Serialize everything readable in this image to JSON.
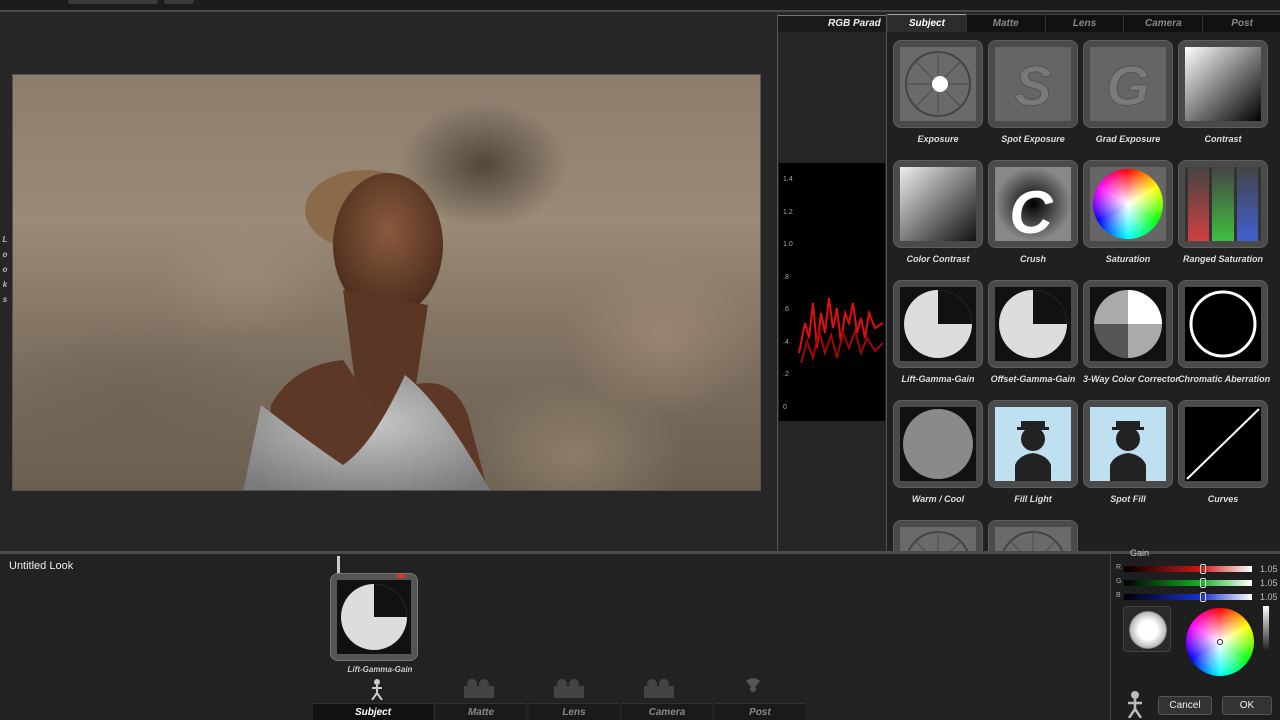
{
  "looks_tab": [
    "L",
    "o",
    "o",
    "k",
    "s"
  ],
  "scope": {
    "title": "RGB Parad",
    "ticks": [
      "1.4",
      "1.2",
      "1.0",
      ".8",
      ".6",
      ".4",
      ".2",
      "0"
    ]
  },
  "fx_tabs": [
    {
      "label": "Subject",
      "active": true
    },
    {
      "label": "Matte",
      "active": false
    },
    {
      "label": "Lens",
      "active": false
    },
    {
      "label": "Camera",
      "active": false
    },
    {
      "label": "Post",
      "active": false
    }
  ],
  "fx_tools": [
    {
      "label": "Exposure",
      "icon": "aperture-icon"
    },
    {
      "label": "Spot Exposure",
      "icon": "letter-s-icon"
    },
    {
      "label": "Grad Exposure",
      "icon": "letter-g-icon"
    },
    {
      "label": "Contrast",
      "icon": "contrast-gradient-icon"
    },
    {
      "label": "Color Contrast",
      "icon": "color-contrast-icon"
    },
    {
      "label": "Crush",
      "icon": "letter-c-icon"
    },
    {
      "label": "Saturation",
      "icon": "color-wheel-icon"
    },
    {
      "label": "Ranged Saturation",
      "icon": "rgb-bars-icon"
    },
    {
      "label": "Lift-Gamma-Gain",
      "icon": "lift-gamma-gain-icon"
    },
    {
      "label": "Offset-Gamma-Gain",
      "icon": "offset-gamma-gain-icon"
    },
    {
      "label": "3-Way Color Corrector",
      "icon": "three-way-icon"
    },
    {
      "label": "Chromatic Aberration",
      "icon": "ring-icon"
    },
    {
      "label": "Warm / Cool",
      "icon": "gray-disc-icon"
    },
    {
      "label": "Fill Light",
      "icon": "silhouette-icon"
    },
    {
      "label": "Spot Fill",
      "icon": "silhouette-icon"
    },
    {
      "label": "Curves",
      "icon": "curve-line-icon"
    }
  ],
  "timeline": {
    "look_name": "Untitled Look",
    "node_label": "Lift-Gamma-Gain"
  },
  "bottom_tabs": [
    {
      "label": "Subject",
      "active": true
    },
    {
      "label": "Matte",
      "active": false
    },
    {
      "label": "Lens",
      "active": false
    },
    {
      "label": "Camera",
      "active": false
    },
    {
      "label": "Post",
      "active": false
    }
  ],
  "controls": {
    "title": "Gain",
    "channels": [
      {
        "name": "R",
        "value": "1.05",
        "fraction": 0.62,
        "color": "#d01818"
      },
      {
        "name": "G",
        "value": "1.05",
        "fraction": 0.62,
        "color": "#18b028"
      },
      {
        "name": "B",
        "value": "1.05",
        "fraction": 0.62,
        "color": "#1830d0"
      }
    ],
    "cancel": "Cancel",
    "ok": "OK"
  }
}
